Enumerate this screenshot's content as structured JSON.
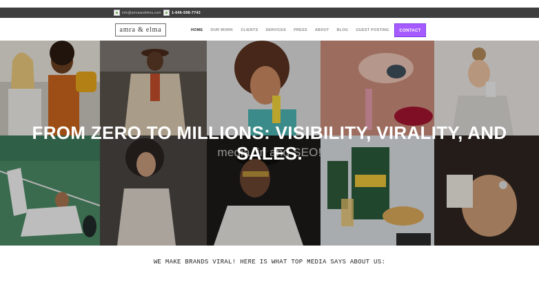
{
  "topbar": {
    "email": "info@amraandelma.com",
    "phone": "1-646-598-7743",
    "icons": [
      "broken-image-icon",
      "broken-image-icon"
    ]
  },
  "header": {
    "logo": "amra & elma",
    "nav": [
      {
        "label": "HOME",
        "active": true
      },
      {
        "label": "OUR WORK",
        "active": false
      },
      {
        "label": "CLIENTS",
        "active": false
      },
      {
        "label": "SERVICES",
        "active": false
      },
      {
        "label": "PRESS",
        "active": false
      },
      {
        "label": "ABOUT",
        "active": false
      },
      {
        "label": "BLOG",
        "active": false
      },
      {
        "label": "GUEST POSTING",
        "active": false
      }
    ],
    "contact_label": "CONTACT",
    "accent_color": "#a55bff"
  },
  "hero": {
    "title_line1": "FROM ZERO TO MILLIONS: VISIBILITY, VIRALITY, AND",
    "title_line2": "SALES.",
    "subtitle": "media, in and SEO!"
  },
  "tagline": "WE MAKE BRANDS VIRAL! HERE IS WHAT TOP MEDIA SAYS ABOUT US:"
}
